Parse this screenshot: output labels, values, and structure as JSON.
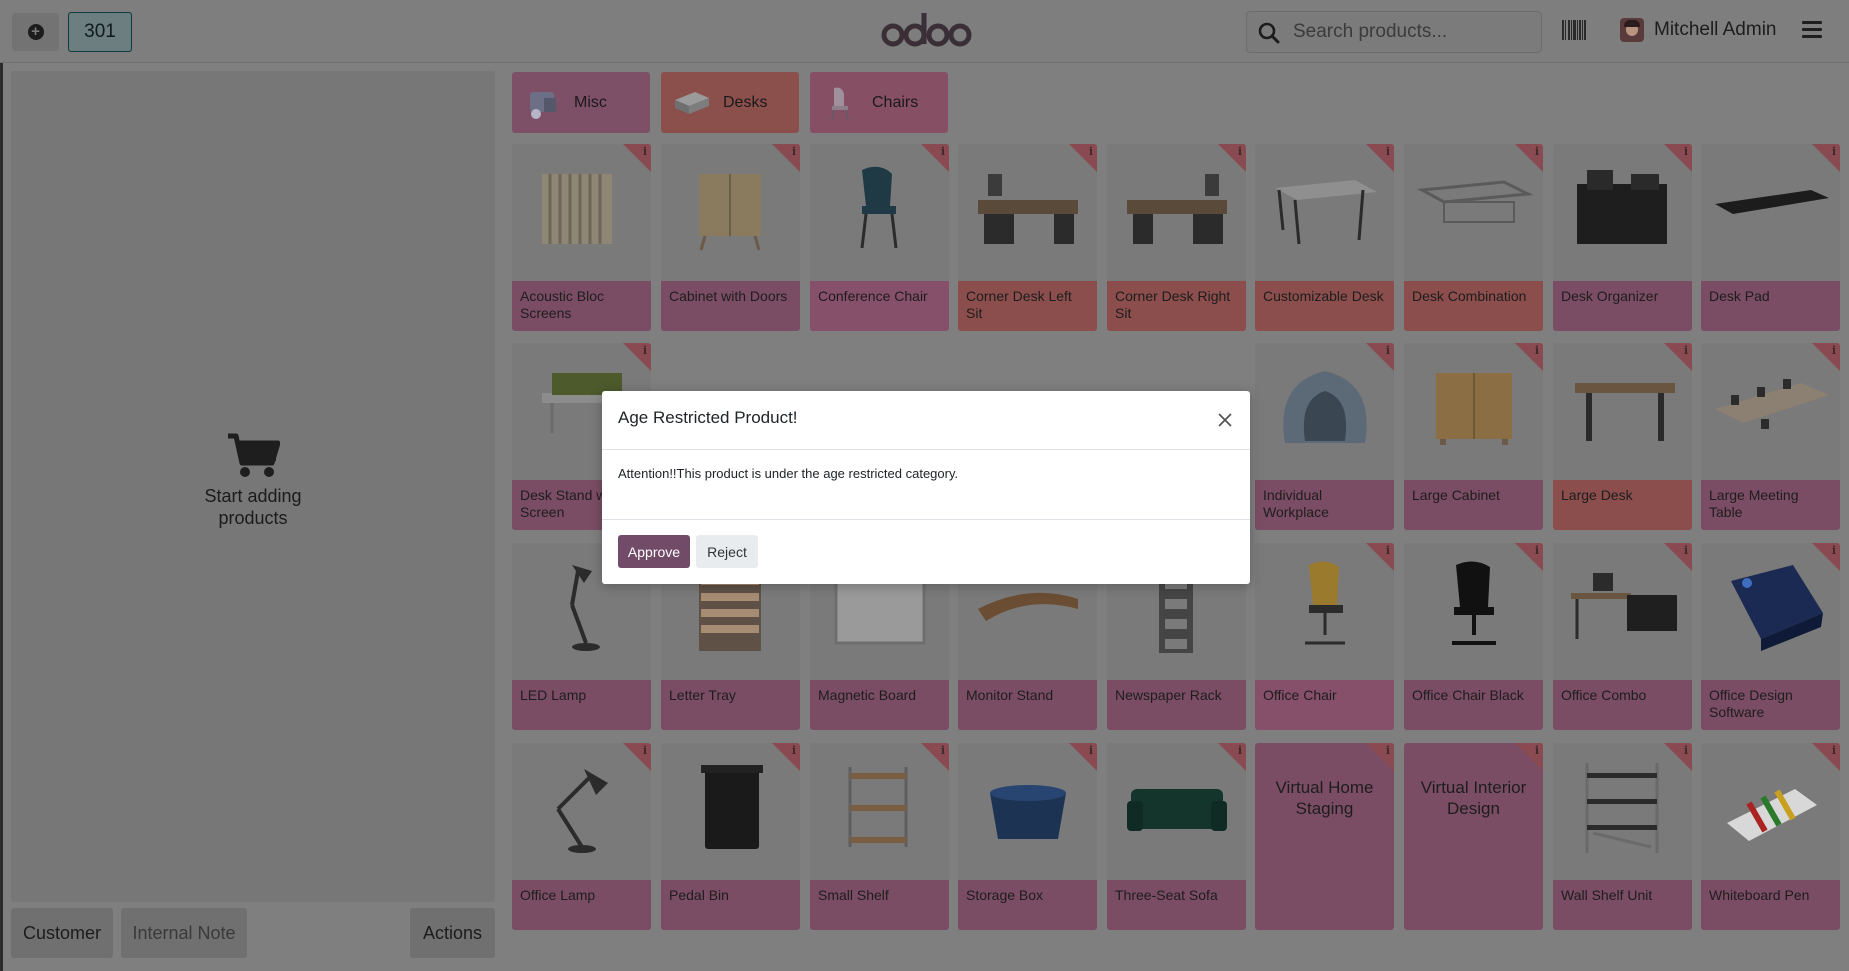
{
  "topbar": {
    "order_number": "301",
    "logo_text": "odoo",
    "search_placeholder": "Search products...",
    "user_name": "Mitchell Admin"
  },
  "cart": {
    "empty_text_line1": "Start adding",
    "empty_text_line2": "products"
  },
  "bottom": {
    "customer_label": "Customer",
    "note_label": "Internal Note",
    "actions_label": "Actions"
  },
  "categories": [
    {
      "label": "Misc"
    },
    {
      "label": "Desks"
    },
    {
      "label": "Chairs"
    }
  ],
  "products": [
    {
      "name": "Acoustic Bloc Screens"
    },
    {
      "name": "Cabinet with Doors"
    },
    {
      "name": "Conference Chair"
    },
    {
      "name": "Corner Desk Left Sit"
    },
    {
      "name": "Corner Desk Right Sit"
    },
    {
      "name": "Customizable Desk"
    },
    {
      "name": "Desk Combination"
    },
    {
      "name": "Desk Organizer"
    },
    {
      "name": "Desk Pad"
    },
    {
      "name": "Desk Stand with Screen"
    },
    {
      "name": "Individual Workplace"
    },
    {
      "name": "Large Cabinet"
    },
    {
      "name": "Large Desk"
    },
    {
      "name": "Large Meeting Table"
    },
    {
      "name": "LED Lamp"
    },
    {
      "name": "Letter Tray"
    },
    {
      "name": "Magnetic Board"
    },
    {
      "name": "Monitor Stand"
    },
    {
      "name": "Newspaper Rack"
    },
    {
      "name": "Office Chair"
    },
    {
      "name": "Office Chair Black"
    },
    {
      "name": "Office Combo"
    },
    {
      "name": "Office Design Software"
    },
    {
      "name": "Office Lamp"
    },
    {
      "name": "Pedal Bin"
    },
    {
      "name": "Small Shelf"
    },
    {
      "name": "Storage Box"
    },
    {
      "name": "Three-Seat Sofa"
    },
    {
      "name": "Virtual Home Staging"
    },
    {
      "name": "Virtual Interior Design"
    },
    {
      "name": "Wall Shelf Unit"
    },
    {
      "name": "Whiteboard Pen"
    }
  ],
  "info_glyph": "i",
  "dialog": {
    "title": "Age Restricted Product!",
    "body": "Attention!!This product is under the age restricted category.",
    "approve_label": "Approve",
    "reject_label": "Reject"
  },
  "colors": {
    "primary": "#714b67",
    "overlay": "#7f7f7f"
  }
}
